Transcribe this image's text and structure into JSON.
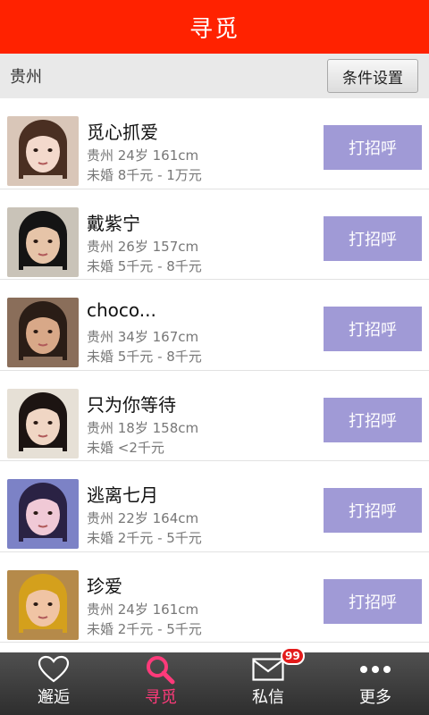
{
  "header": {
    "title": "寻觅"
  },
  "filter": {
    "city": "贵州",
    "settings_label": "条件设置"
  },
  "users": [
    {
      "name": "觅心抓爱",
      "line1": "贵州 24岁 161cm",
      "line2": "未婚 8千元 - 1万元",
      "button": "打招呼",
      "bg": "#d9c6b8",
      "skin": "#f3d9cc",
      "hair": "#4a2f22"
    },
    {
      "name": "戴紫宁",
      "line1": "贵州 26岁 157cm",
      "line2": "未婚 5千元 - 8千元",
      "button": "打招呼",
      "bg": "#c9c3b8",
      "skin": "#e6c4a8",
      "hair": "#141414"
    },
    {
      "name": "choco...",
      "line1": "贵州 34岁 167cm",
      "line2": "未婚 5千元 - 8千元",
      "button": "打招呼",
      "bg": "#8a6e5a",
      "skin": "#d8a888",
      "hair": "#2a1d16"
    },
    {
      "name": "只为你等待",
      "line1": "贵州 18岁 158cm",
      "line2": "未婚 <2千元",
      "button": "打招呼",
      "bg": "#e6e0d6",
      "skin": "#f0d6c4",
      "hair": "#1c1412"
    },
    {
      "name": "逃离七月",
      "line1": "贵州 22岁 164cm",
      "line2": "未婚 2千元 - 5千元",
      "button": "打招呼",
      "bg": "#7c82c6",
      "skin": "#f0c9d6",
      "hair": "#2a2244"
    },
    {
      "name": "珍爱",
      "line1": "贵州 24岁 161cm",
      "line2": "未婚 2千元 - 5千元",
      "button": "打招呼",
      "bg": "#b58a4a",
      "skin": "#f0c4a4",
      "hair": "#d4a01c"
    }
  ],
  "tabs": [
    {
      "label": "邂逅",
      "icon": "heart-icon"
    },
    {
      "label": "寻觅",
      "icon": "search-icon"
    },
    {
      "label": "私信",
      "icon": "mail-icon",
      "badge": "99"
    },
    {
      "label": "更多",
      "icon": "more-icon"
    }
  ],
  "colors": {
    "header": "#ff2200",
    "button": "#a09ad6",
    "active_tab": "#ff3a7a"
  }
}
